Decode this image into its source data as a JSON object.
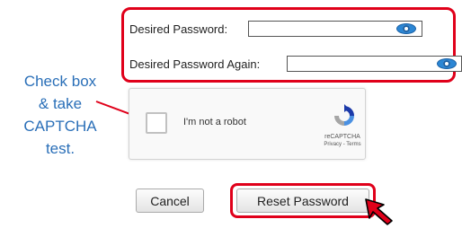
{
  "form": {
    "desired_password_label": "Desired Password:",
    "desired_password_value": "",
    "desired_password_again_label": "Desired Password Again:",
    "desired_password_again_value": ""
  },
  "annotation": {
    "line1": "Check box",
    "line2": "& take",
    "line3": "CAPTCHA",
    "line4": "test."
  },
  "captcha": {
    "label": "I'm not a robot",
    "brand": "reCAPTCHA",
    "links": "Privacy - Terms"
  },
  "buttons": {
    "cancel": "Cancel",
    "reset": "Reset Password"
  },
  "colors": {
    "highlight": "#e0001a",
    "annotation_text": "#2a6fb8",
    "eye_icon": "#2b86d4"
  },
  "icons": [
    "eye-icon",
    "recaptcha-logo-icon",
    "cursor-arrow-icon",
    "annotation-arrow-icon"
  ]
}
